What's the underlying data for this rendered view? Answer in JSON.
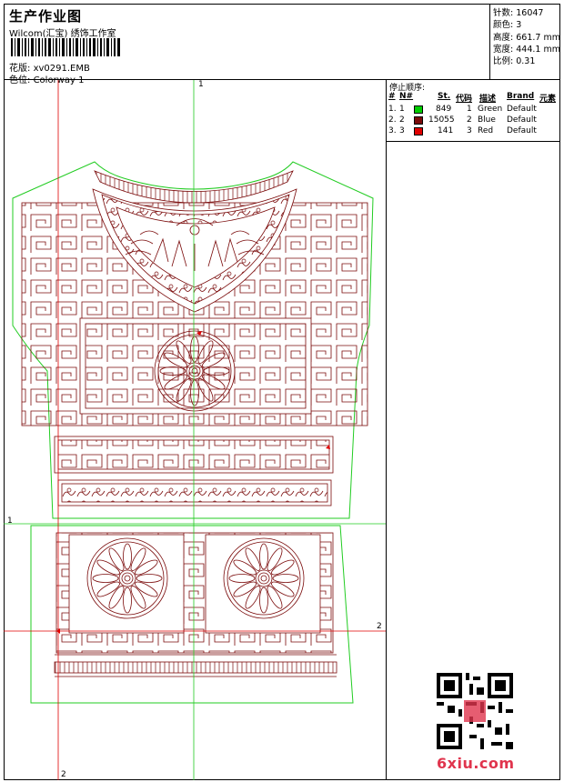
{
  "header": {
    "title": "生产作业图",
    "subtitle": "Wilcom(汇宝) 绣饰工作室",
    "design_label": "花版:",
    "design_file": "xv0291.EMB",
    "colorway_label": "色位:",
    "colorway": "Colorway 1"
  },
  "stats": {
    "stitches_label": "针数:",
    "stitches": "16047",
    "colors_label": "颜色:",
    "colors": "3",
    "height_label": "高度:",
    "height": "661.7 mm",
    "width_label": "宽度:",
    "width": "444.1 mm",
    "scale_label": "比例:",
    "scale": "0.31"
  },
  "stop_sequence": {
    "title": "停止顺序:",
    "columns": [
      "#",
      "N#",
      "St.",
      "代码",
      "描述",
      "Brand",
      "元素"
    ],
    "rows": [
      {
        "idx": "1.",
        "n": "1",
        "color": "#00cc00",
        "st": "849",
        "code": "1",
        "desc": "Green",
        "brand": "Default"
      },
      {
        "idx": "2.",
        "n": "2",
        "color": "#7a0a0a",
        "st": "15055",
        "code": "2",
        "desc": "Blue",
        "brand": "Default"
      },
      {
        "idx": "3.",
        "n": "3",
        "color": "#e00000",
        "st": "141",
        "code": "3",
        "desc": "Red",
        "brand": "Default"
      }
    ]
  },
  "axes": {
    "v1_top": "1",
    "v2_bottom": "2",
    "h1_left": "1",
    "h2_right": "2"
  },
  "colors": {
    "outline_green": "#22cc22",
    "stitch_dark": "#7a0a0a",
    "guide_red": "#e00000",
    "guide_green": "#22cc22"
  },
  "watermark": "6xiu.com",
  "qr_icon": "qr-code-icon"
}
